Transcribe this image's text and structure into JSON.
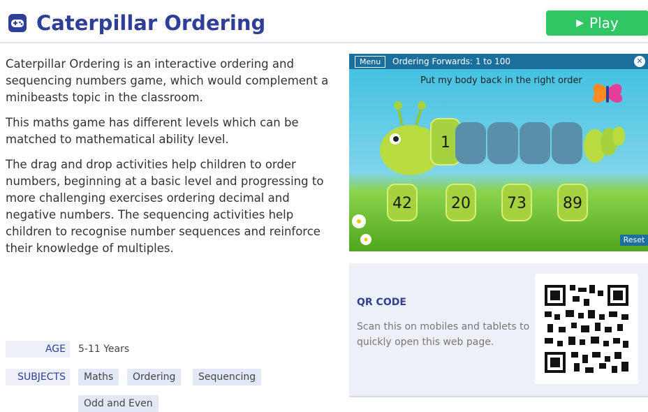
{
  "page": {
    "title": "Caterpillar Ordering",
    "title_icon": "gamepad-icon",
    "play_label": "Play"
  },
  "description": [
    "Caterpillar Ordering is an interactive ordering and sequencing numbers game, which would complement a minibeasts topic in the classroom.",
    "This maths game has different levels which can be matched to mathematical ability level.",
    "The drag and drop activities help children to order numbers, beginning at a basic level and progressing to more challenging exercises ordering decimal and negative numbers. The sequencing activities help children to recognise number sequences and reinforce their knowledge of multiples."
  ],
  "meta": {
    "age_label": "AGE",
    "age_value": "5-11 Years",
    "subjects_label": "SUBJECTS",
    "subjects": [
      "Maths",
      "Ordering",
      "Sequencing",
      "Odd and Even"
    ]
  },
  "game": {
    "menu_label": "Menu",
    "title": "Ordering Forwards: 1 to 100",
    "instruction": "Put my body back in the right order",
    "head_number": "1",
    "pieces": [
      "42",
      "20",
      "73",
      "89"
    ],
    "reset_label": "Reset"
  },
  "qr": {
    "title": "QR CODE",
    "text": "Scan this on mobiles and tablets to quickly open this web page."
  },
  "colors": {
    "brand": "#2f3f97",
    "play": "#2ec764"
  }
}
